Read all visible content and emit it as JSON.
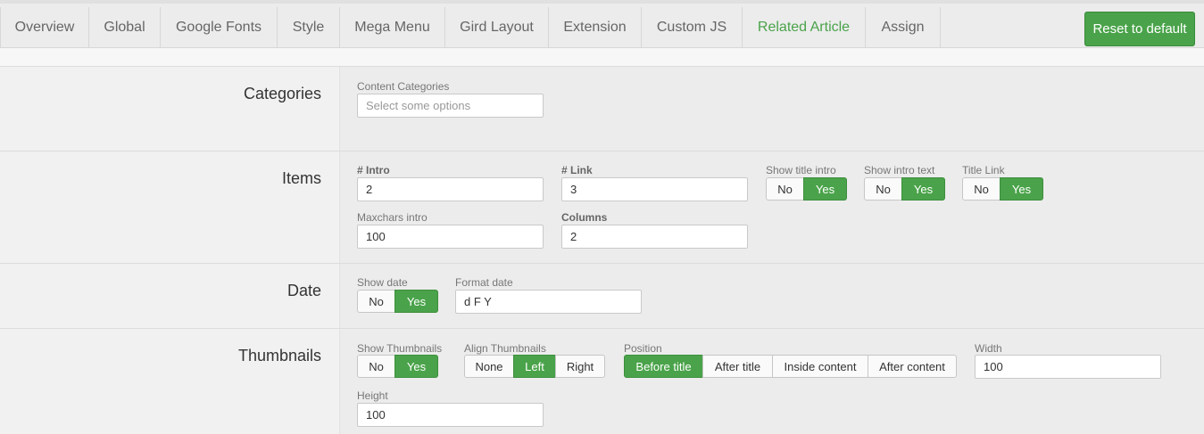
{
  "tabs": [
    {
      "label": "Overview",
      "active": false
    },
    {
      "label": "Global",
      "active": false
    },
    {
      "label": "Google Fonts",
      "active": false
    },
    {
      "label": "Style",
      "active": false
    },
    {
      "label": "Mega Menu",
      "active": false
    },
    {
      "label": "Gird Layout",
      "active": false
    },
    {
      "label": "Extension",
      "active": false
    },
    {
      "label": "Custom JS",
      "active": false
    },
    {
      "label": "Related Article",
      "active": true
    },
    {
      "label": "Assign",
      "active": false
    }
  ],
  "reset_label": "Reset to default",
  "colors": {
    "accent": "#4aa34a",
    "tab_active": "#4aa34a"
  },
  "categories": {
    "title": "Categories",
    "content_categories_label": "Content Categories",
    "content_categories_placeholder": "Select some options"
  },
  "items": {
    "title": "Items",
    "intro_label": "# Intro",
    "intro_value": "2",
    "link_label": "# Link",
    "link_value": "3",
    "show_title_intro_label": "Show title intro",
    "show_intro_text_label": "Show intro text",
    "title_link_label": "Title Link",
    "no_label": "No",
    "yes_label": "Yes",
    "maxchars_label": "Maxchars intro",
    "maxchars_value": "100",
    "columns_label": "Columns",
    "columns_value": "2"
  },
  "date": {
    "title": "Date",
    "show_date_label": "Show date",
    "no_label": "No",
    "yes_label": "Yes",
    "format_label": "Format date",
    "format_value": "d F Y"
  },
  "thumbnails": {
    "title": "Thumbnails",
    "show_label": "Show Thumbnails",
    "no_label": "No",
    "yes_label": "Yes",
    "align_label": "Align Thumbnails",
    "align_options": [
      "None",
      "Left",
      "Right"
    ],
    "align_selected": "Left",
    "position_label": "Position",
    "position_options": [
      "Before title",
      "After title",
      "Inside content",
      "After content"
    ],
    "position_selected": "Before title",
    "width_label": "Width",
    "width_value": "100",
    "height_label": "Height",
    "height_value": "100"
  }
}
